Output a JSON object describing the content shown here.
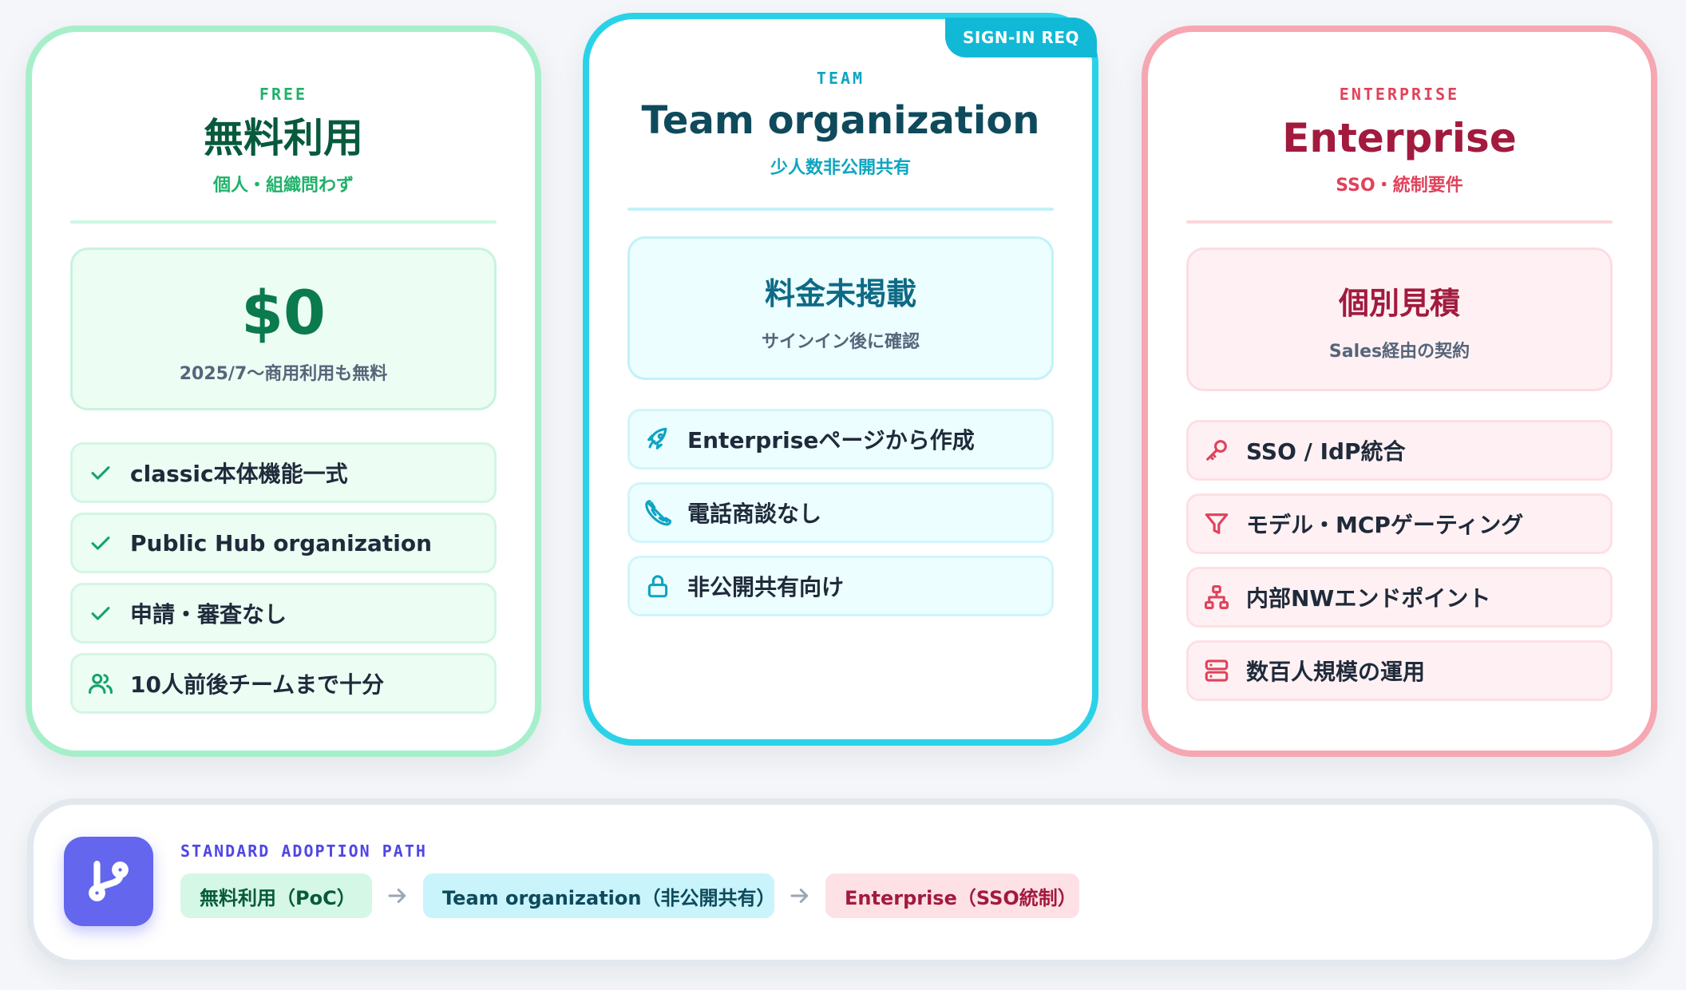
{
  "plans": {
    "free": {
      "tier": "FREE",
      "title": "無料利用",
      "subtitle": "個人・組織問わず",
      "price": "$0",
      "price_note": "2025/7〜商用利用も無料",
      "accent_color": "#1fb26a",
      "features": [
        {
          "icon": "check-icon",
          "label": "classic本体機能一式"
        },
        {
          "icon": "check-icon",
          "label": "Public Hub organization"
        },
        {
          "icon": "check-icon",
          "label": "申請・審査なし"
        },
        {
          "icon": "users-icon",
          "label": "10人前後チームまで十分"
        }
      ]
    },
    "team": {
      "badge": "SIGN-IN REQ",
      "tier": "TEAM",
      "title": "Team organization",
      "subtitle": "少人数非公開共有",
      "price": "料金未掲載",
      "price_note": "サインイン後に確認",
      "accent_color": "#12b9d6",
      "features": [
        {
          "icon": "rocket-icon",
          "label": "Enterpriseページから作成"
        },
        {
          "icon": "phone-off-icon",
          "label": "電話商談なし"
        },
        {
          "icon": "lock-icon",
          "label": "非公開共有向け"
        }
      ]
    },
    "enterprise": {
      "tier": "ENTERPRISE",
      "title": "Enterprise",
      "subtitle": "SSO・統制要件",
      "price": "個別見積",
      "price_note": "Sales経由の契約",
      "accent_color": "#e0425a",
      "features": [
        {
          "icon": "key-icon",
          "label": "SSO / IdP統合"
        },
        {
          "icon": "filter-icon",
          "label": "モデル・MCPゲーティング"
        },
        {
          "icon": "network-icon",
          "label": "内部NWエンドポイント"
        },
        {
          "icon": "server-icon",
          "label": "数百人規模の運用"
        }
      ]
    }
  },
  "adoption_path": {
    "label": "STANDARD ADOPTION PATH",
    "icon": "git-branch-icon",
    "steps": [
      "無料利用（PoC）",
      "Team organization（非公開共有）",
      "Enterprise（SSO統制）"
    ],
    "arrow_icon": "arrow-right-icon"
  }
}
